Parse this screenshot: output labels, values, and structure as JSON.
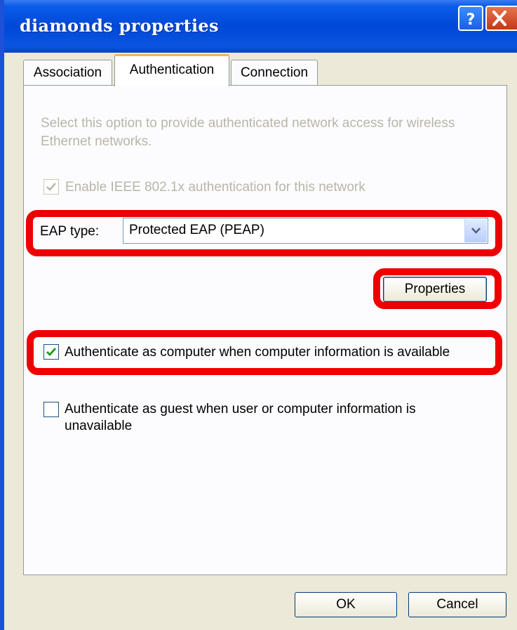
{
  "window": {
    "title": "diamonds properties",
    "help_icon": "question-mark-icon",
    "close_icon": "close-x-icon"
  },
  "tabs": [
    {
      "label": "Association",
      "selected": false
    },
    {
      "label": "Authentication",
      "selected": true
    },
    {
      "label": "Connection",
      "selected": false
    }
  ],
  "auth": {
    "description": "Select this option to provide authenticated network access for wireless Ethernet networks.",
    "enable_8021x": {
      "label": "Enable IEEE 802.1x authentication for this network",
      "checked": true,
      "disabled": true
    },
    "eap_type_label": "EAP type:",
    "eap_type_value": "Protected EAP (PEAP)",
    "properties_button": "Properties",
    "auth_as_computer": {
      "label": "Authenticate as computer when computer information is available",
      "checked": true
    },
    "auth_as_guest": {
      "label": "Authenticate as guest when user or computer information is unavailable",
      "checked": false
    }
  },
  "buttons": {
    "ok": "OK",
    "cancel": "Cancel"
  },
  "colors": {
    "titlebar": "#0048d8",
    "highlight": "#ee0000",
    "check": "#21a121"
  }
}
